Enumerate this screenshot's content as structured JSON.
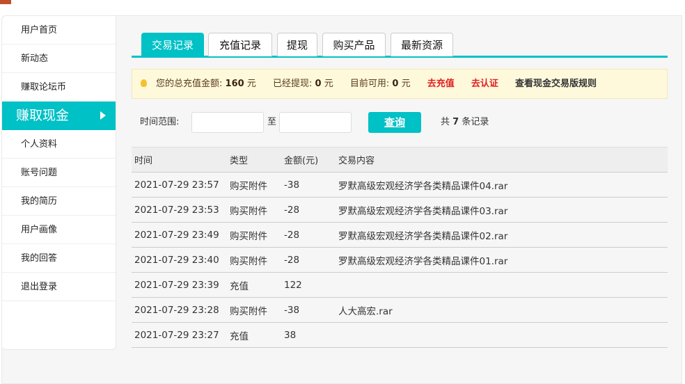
{
  "sidebar": {
    "items": [
      "用户首页",
      "新动态",
      "赚取论坛币",
      "赚取现金",
      "个人资料",
      "账号问题",
      "我的简历",
      "用户画像",
      "我的回答",
      "退出登录"
    ],
    "active_index": 3
  },
  "tabs": [
    "交易记录",
    "充值记录",
    "提现",
    "购买产品",
    "最新资源"
  ],
  "notice": {
    "total_label": "您的总充值金额:",
    "total": "160",
    "withdrawn_label": "已经提现:",
    "withdrawn": "0",
    "available_label": "目前可用:",
    "available": "0",
    "unit": "元",
    "recharge": "去充值",
    "verify": "去认证",
    "rules": "查看现金交易版规则"
  },
  "filter": {
    "label": "时间范围:",
    "to": "至",
    "query": "查询",
    "count_prefix": "共",
    "count": "7",
    "count_suffix": "条记录"
  },
  "table": {
    "headers": [
      "时间",
      "类型",
      "金额(元)",
      "交易内容"
    ],
    "rows": [
      [
        "2021-07-29 23:57",
        "购买附件",
        "-38",
        "罗默高级宏观经济学各类精品课件04.rar"
      ],
      [
        "2021-07-29 23:53",
        "购买附件",
        "-28",
        "罗默高级宏观经济学各类精品课件03.rar"
      ],
      [
        "2021-07-29 23:49",
        "购买附件",
        "-28",
        "罗默高级宏观经济学各类精品课件02.rar"
      ],
      [
        "2021-07-29 23:40",
        "购买附件",
        "-28",
        "罗默高级宏观经济学各类精品课件01.rar"
      ],
      [
        "2021-07-29 23:39",
        "充值",
        "122",
        ""
      ],
      [
        "2021-07-29 23:28",
        "购买附件",
        "-38",
        "人大高宏.rar"
      ],
      [
        "2021-07-29 23:27",
        "充值",
        "38",
        ""
      ]
    ]
  }
}
